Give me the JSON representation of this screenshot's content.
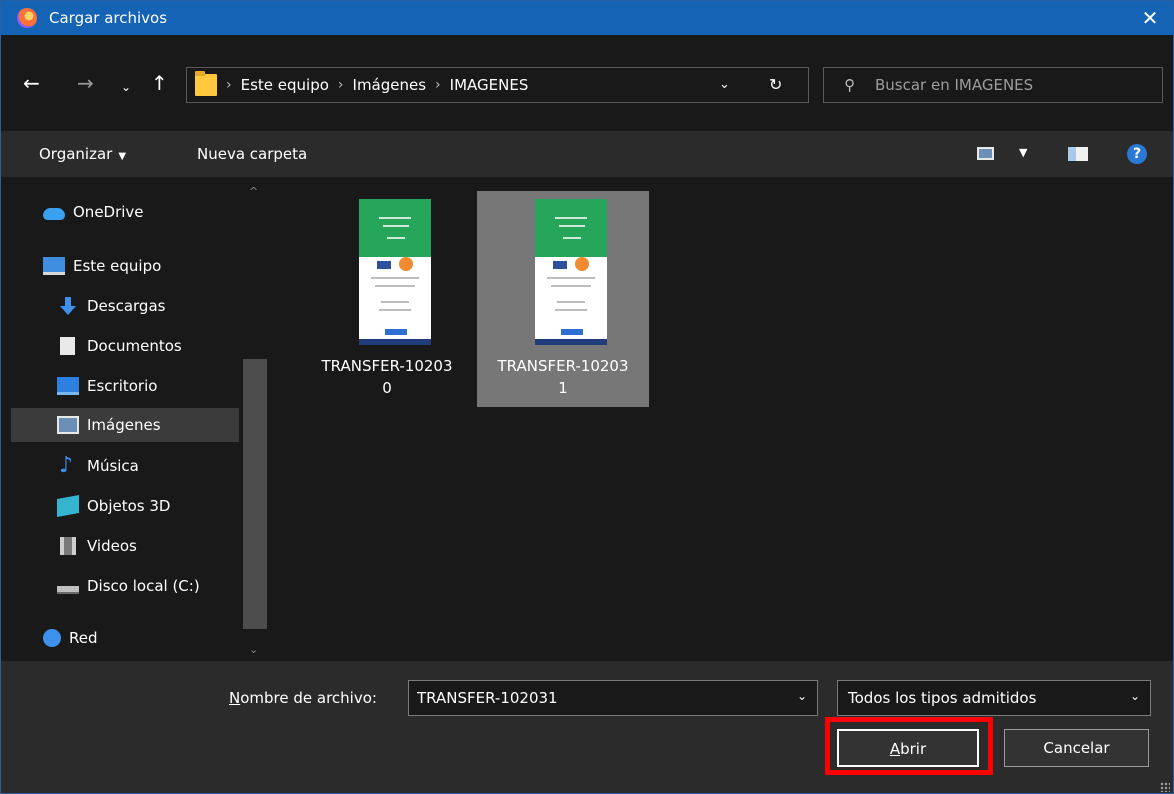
{
  "window": {
    "title": "Cargar archivos",
    "close_glyph": "✕"
  },
  "nav": {
    "back": "←",
    "forward": "→",
    "recent": "⌄",
    "up": "↑"
  },
  "address": {
    "crumbs": [
      "Este equipo",
      "Imágenes",
      "IMAGENES"
    ],
    "separator": "›",
    "dropdown": "⌄",
    "refresh": "↻"
  },
  "search": {
    "placeholder": "Buscar en IMAGENES",
    "icon": "⚲"
  },
  "toolbar": {
    "organize": "Organizar",
    "organize_caret": "▼",
    "new_folder": "Nueva carpeta",
    "view_caret": "▼",
    "help": "?"
  },
  "sidebar": {
    "items": [
      {
        "label": "OneDrive",
        "icon": "cloud-icon"
      },
      {
        "label": "Este equipo",
        "icon": "computer-icon"
      },
      {
        "label": "Descargas",
        "icon": "download-icon"
      },
      {
        "label": "Documentos",
        "icon": "document-icon"
      },
      {
        "label": "Escritorio",
        "icon": "desktop-icon"
      },
      {
        "label": "Imágenes",
        "icon": "pictures-icon",
        "selected": true
      },
      {
        "label": "Música",
        "icon": "music-icon"
      },
      {
        "label": "Objetos 3D",
        "icon": "cube-icon"
      },
      {
        "label": "Videos",
        "icon": "video-icon"
      },
      {
        "label": "Disco local (C:)",
        "icon": "disk-icon"
      },
      {
        "label": "Red",
        "icon": "network-icon"
      }
    ],
    "scroll_up": "^",
    "scroll_down": "⌄"
  },
  "files": [
    {
      "name_line1": "TRANSFER-10203",
      "name_line2": "0",
      "selected": false
    },
    {
      "name_line1": "TRANSFER-10203",
      "name_line2": "1",
      "selected": true
    }
  ],
  "footer": {
    "filename_label_key": "N",
    "filename_label_rest": "ombre de archivo:",
    "filename_value": "TRANSFER-102031",
    "filename_dropdown": "⌄",
    "filetype_value": "Todos los tipos admitidos",
    "filetype_dropdown": "⌄",
    "open_key": "A",
    "open_rest": "brir",
    "cancel": "Cancelar"
  },
  "colors": {
    "titlebar": "#1463b4",
    "accent_highlight": "#ff0000",
    "background": "#191919"
  }
}
